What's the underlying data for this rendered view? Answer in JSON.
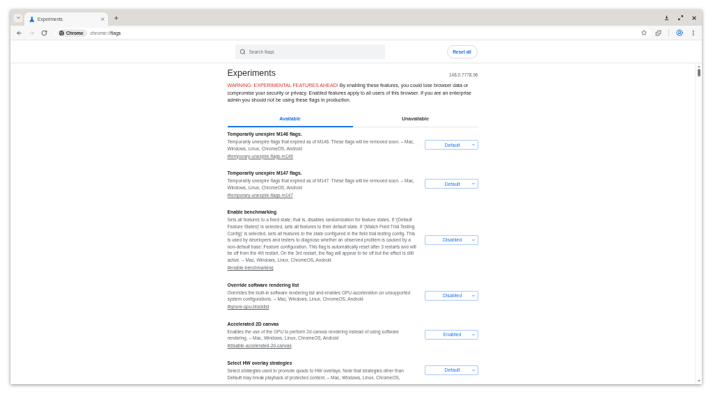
{
  "browser": {
    "tabs": [
      {
        "title": "Experiments",
        "selected": true
      }
    ],
    "nav": [
      {
        "kind": "back",
        "disabled": false
      },
      {
        "kind": "forward",
        "disabled": true
      },
      {
        "kind": "reload",
        "disabled": false
      }
    ],
    "address": {
      "chip": "Chrome",
      "scheme": "chrome://",
      "path": "flags"
    }
  },
  "page": {
    "search": {
      "placeholder": "Search flags"
    },
    "reset_button": "Reset all",
    "title": "Experiments",
    "version": "148.0.7778.96",
    "warning": {
      "lead": "WARNING: EXPERIMENTAL FEATURES AHEAD!",
      "text": "By enabling these features, you could lose browser data or compromise your security or privacy. Enabled features apply to all users of this browser. If you are an enterprise admin you should not be using these flags in production."
    },
    "tabs": [
      {
        "label": "Available",
        "selected": true
      },
      {
        "label": "Unavailable",
        "selected": false
      }
    ],
    "flags": [
      {
        "name": "Temporarily unexpire M146 flags.",
        "description": "Temporarily unexpire flags that expired as of M146. These flags will be removed soon. – Mac, Windows, Linux, ChromeOS, Android",
        "link": "#temporary-unexpire-flags-m146",
        "value": "Default"
      },
      {
        "name": "Temporarily unexpire M147 flags.",
        "description": "Temporarily unexpire flags that expired as of M147. These flags will be removed soon. – Mac, Windows, Linux, ChromeOS, Android",
        "link": "#temporary-unexpire-flags-m147",
        "value": "Default"
      },
      {
        "name": "Enable benchmarking",
        "description": "Sets all features to a fixed state; that is, disables randomization for feature states. If '(Default Feature States)' is selected, sets all features to their default state. If '(Match Field Trial Testing Config)' is selected, sets all features to the state configured in the field trial testing config. This is used by developers and testers to diagnose whether an observed problem is caused by a non-default base::Feature configuration. This flag is automatically reset after 3 restarts and will be off from the 4th restart. On the 3rd restart, the flag will appear to be off but the effect is still active. – Mac, Windows, Linux, ChromeOS, Android",
        "link": "#enable-benchmarking",
        "value": "Disabled"
      },
      {
        "name": "Override software rendering list",
        "description": "Overrides the built-in software rendering list and enables GPU-acceleration on unsupported system configurations. – Mac, Windows, Linux, ChromeOS, Android",
        "link": "#ignore-gpu-blocklist",
        "value": "Disabled"
      },
      {
        "name": "Accelerated 2D canvas",
        "description": "Enables the use of the GPU to perform 2d canvas rendering instead of using software rendering. – Mac, Windows, Linux, ChromeOS, Android",
        "link": "#disable-accelerated-2d-canvas",
        "value": "Enabled"
      },
      {
        "name": "Select HW overlay strategies",
        "description": "Select strategies used to promote quads to HW overlays. Note that strategies other than Default may break playback of protected content. – Mac, Windows, Linux, ChromeOS,",
        "value": "Default"
      }
    ]
  }
}
